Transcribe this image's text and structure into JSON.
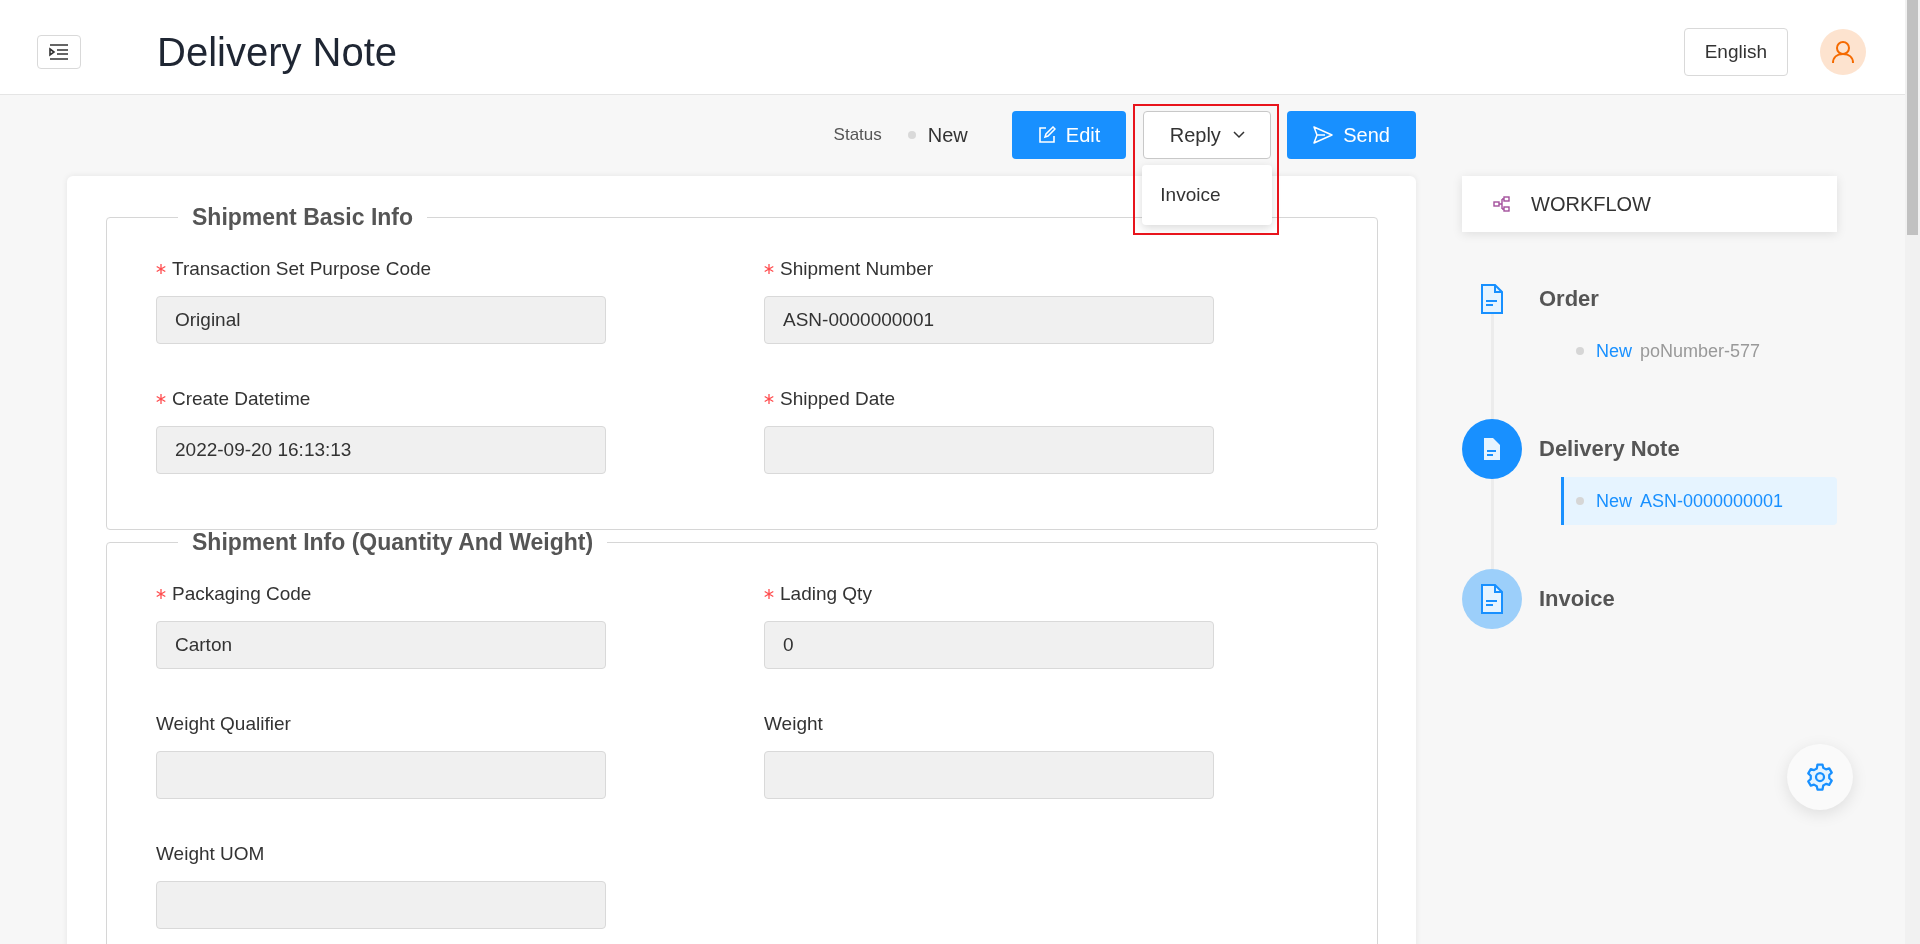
{
  "header": {
    "title": "Delivery Note",
    "language": "English"
  },
  "toolbar": {
    "status_label": "Status",
    "status": "New",
    "buttons": [
      {
        "label": "Edit",
        "kind": "edit"
      },
      {
        "label": "Reply",
        "kind": "dropdown",
        "expanded": true,
        "highlighted": true,
        "menu": [
          "Invoice"
        ]
      },
      {
        "label": "Send",
        "kind": "send"
      }
    ]
  },
  "sections": [
    {
      "title": "Shipment Basic Info",
      "fields": [
        {
          "label": "Transaction Set Purpose Code",
          "required": true,
          "value": "Original"
        },
        {
          "label": "Shipment Number",
          "required": true,
          "value": "ASN-0000000001"
        },
        {
          "label": "Create Datetime",
          "required": true,
          "value": "2022-09-20 16:13:13"
        },
        {
          "label": "Shipped Date",
          "required": true
        }
      ]
    },
    {
      "title": "Shipment Info (Quantity And Weight)",
      "fields": [
        {
          "label": "Packaging Code",
          "required": true,
          "value": "Carton"
        },
        {
          "label": "Lading Qty",
          "required": true,
          "value": "0"
        },
        {
          "label": "Weight Qualifier",
          "required": false
        },
        {
          "label": "Weight",
          "required": false
        },
        {
          "label": "Weight UOM",
          "required": false
        }
      ]
    }
  ],
  "workflow": {
    "title": "WORKFLOW",
    "steps": [
      {
        "title": "Order",
        "kind": "done",
        "entries": [
          {
            "status": "New",
            "number": "poNumber-577",
            "selected": false
          }
        ]
      },
      {
        "title": "Delivery Note",
        "kind": "current",
        "entries": [
          {
            "status": "New",
            "number": "ASN-0000000001",
            "selected": true
          }
        ]
      },
      {
        "title": "Invoice",
        "kind": "pending"
      }
    ]
  }
}
